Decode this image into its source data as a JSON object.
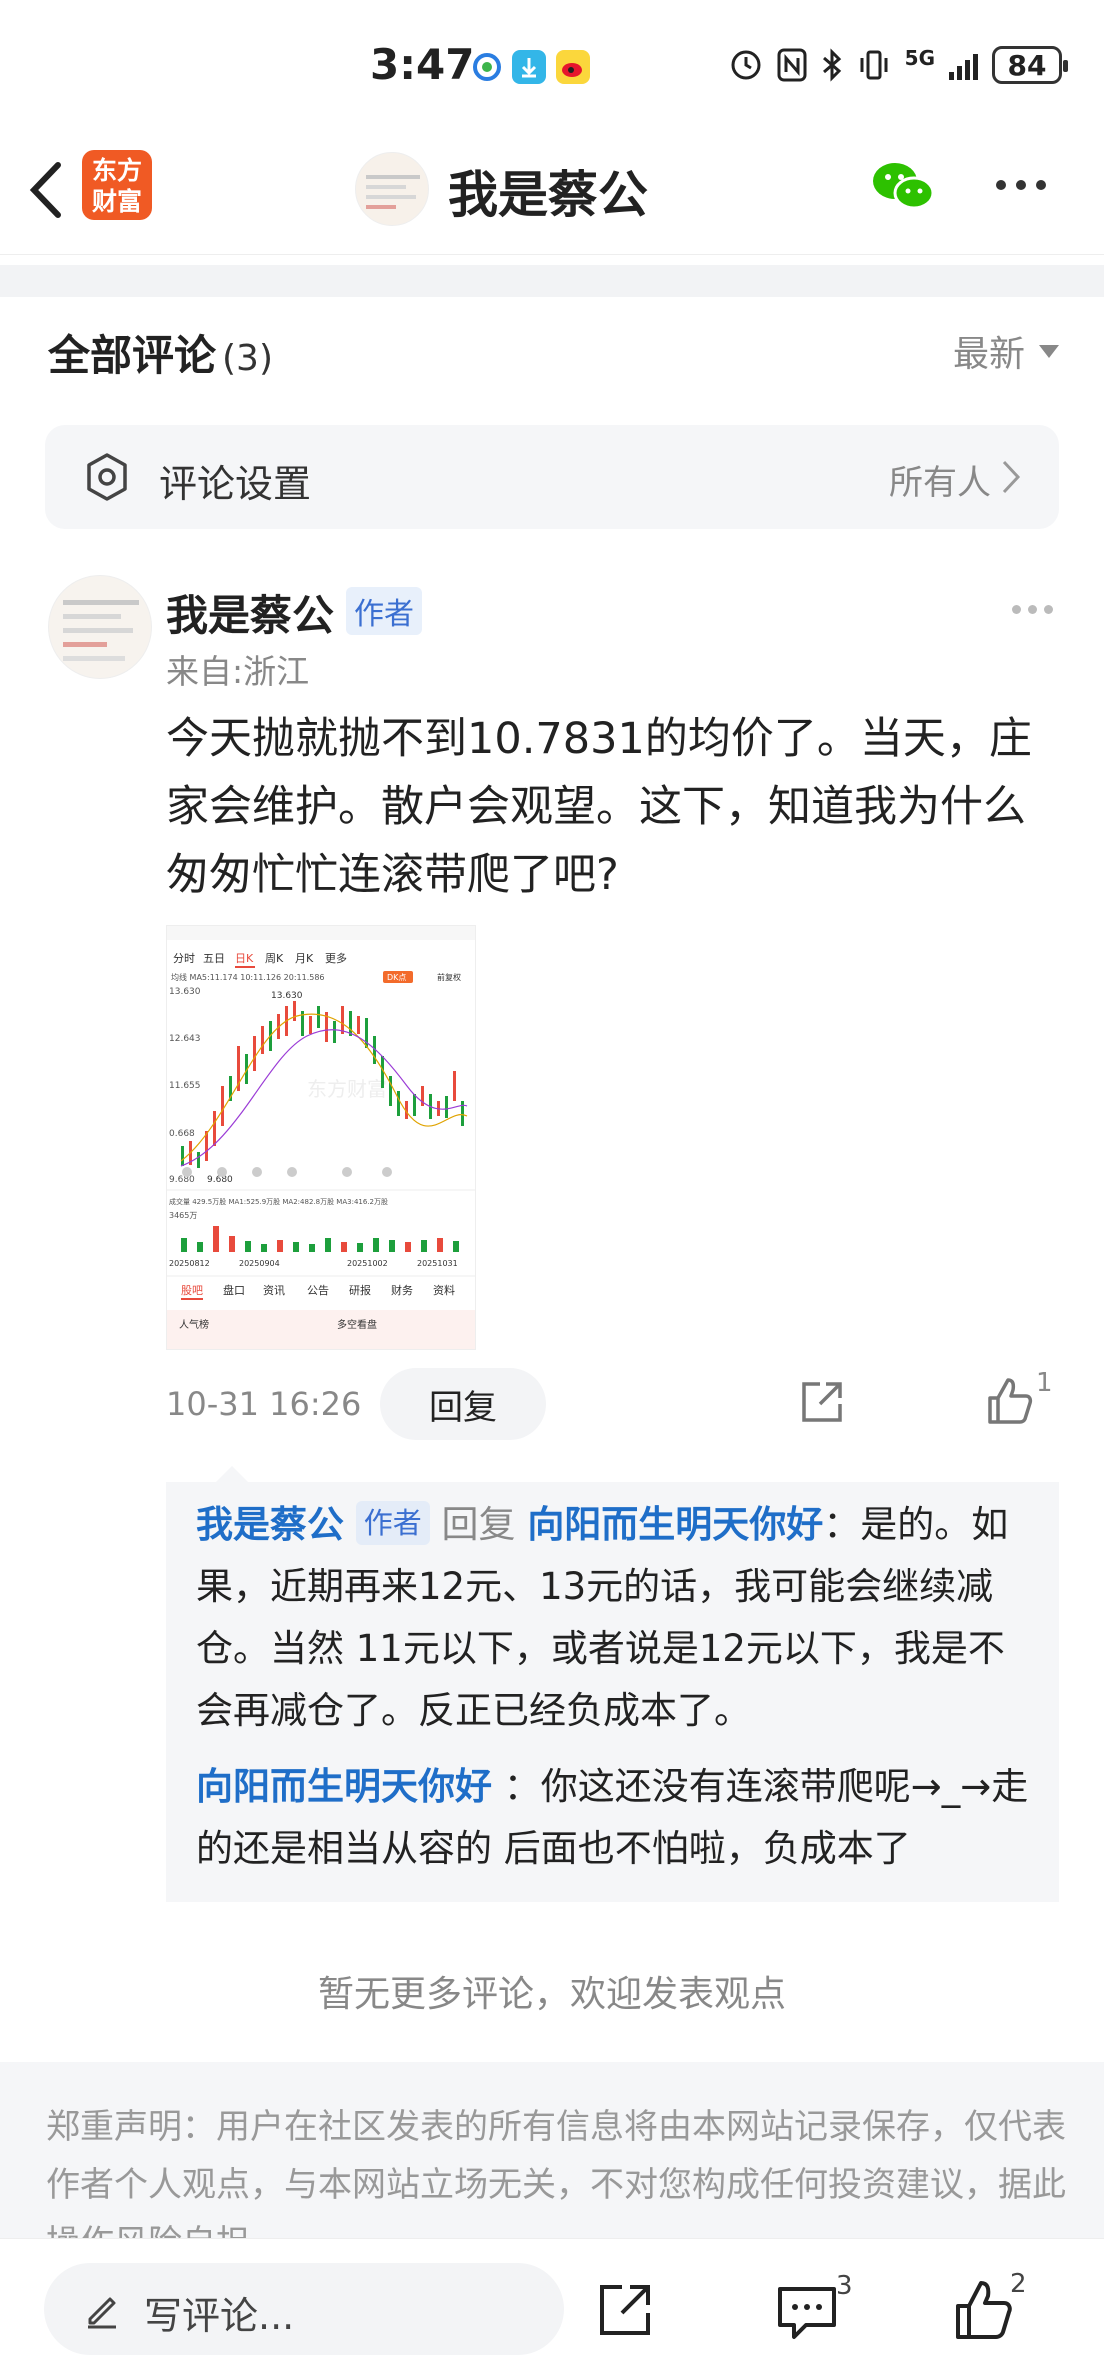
{
  "status_bar": {
    "time": "3:47",
    "network": "5G",
    "battery": "84"
  },
  "nav": {
    "logo_line1": "东方",
    "logo_line2": "财富",
    "title": "我是蔡公"
  },
  "comments_header": {
    "title": "全部评论",
    "count": "(3)",
    "sort_label": "最新"
  },
  "settings": {
    "label": "评论设置",
    "value": "所有人"
  },
  "comment": {
    "author": "我是蔡公",
    "author_tag": "作者",
    "location": "来自:浙江",
    "body": "今天抛就抛不到10.7831的均价了。当天，庄家会维护。散户会观望。这下，知道我为什么匆匆忙忙连滚带爬了吧?",
    "time": "10-31 16:26",
    "reply_label": "回复",
    "like_count": "1",
    "image": {
      "tabs": [
        "分时",
        "五日",
        "日K",
        "周K",
        "月K",
        "更多"
      ],
      "ma_line": "均线 MA5:11.174 10:11.126 20:11.586",
      "prices": [
        "13.630",
        "12.643",
        "11.655",
        "0.668",
        "9.680"
      ],
      "high_label": "13.630",
      "low_label": "9.680",
      "volume_line": "成交量 429.5万股 MA1:525.9万股 MA2:482.8万股 MA3:416.2万股",
      "volume_max": "3465万",
      "dates": [
        "20250812",
        "20250904",
        "20251002",
        "20251031"
      ],
      "bottom_tabs": [
        "股吧",
        "盘口",
        "资讯",
        "公告",
        "研报",
        "财务",
        "资料"
      ],
      "footer_left": "人气榜",
      "footer_right": "多空看盘",
      "watermark": "东方财富",
      "dk_label": "DK点",
      "fq_label": "前复权"
    }
  },
  "replies": [
    {
      "author": "我是蔡公",
      "tag": "作者",
      "verb": "回复",
      "target": "向阳而生明天你好",
      "text": "：是的。如果，近期再来12元、13元的话，我可能会继续减仓。当然 11元以下，或者说是12元以下，我是不会再减仓了。反正已经负成本了。"
    },
    {
      "author": "向阳而生明天你好",
      "text": " ：你这还没有连滚带爬呢→_→走的还是相当从容的 后面也不怕啦，负成本了"
    }
  ],
  "no_more": "暂无更多评论，欢迎发表观点",
  "disclaimer": "郑重声明：用户在社区发表的所有信息将由本网站记录保存，仅代表作者个人观点，与本网站立场无关，不对您构成任何投资建议，据此操作风险自担。",
  "bottom_bar": {
    "placeholder": "写评论...",
    "comment_count": "3",
    "like_count": "2"
  },
  "colors": {
    "accent_blue": "#1f6ec8",
    "logo_orange": "#f05a24",
    "wechat_green": "#2dc100"
  }
}
